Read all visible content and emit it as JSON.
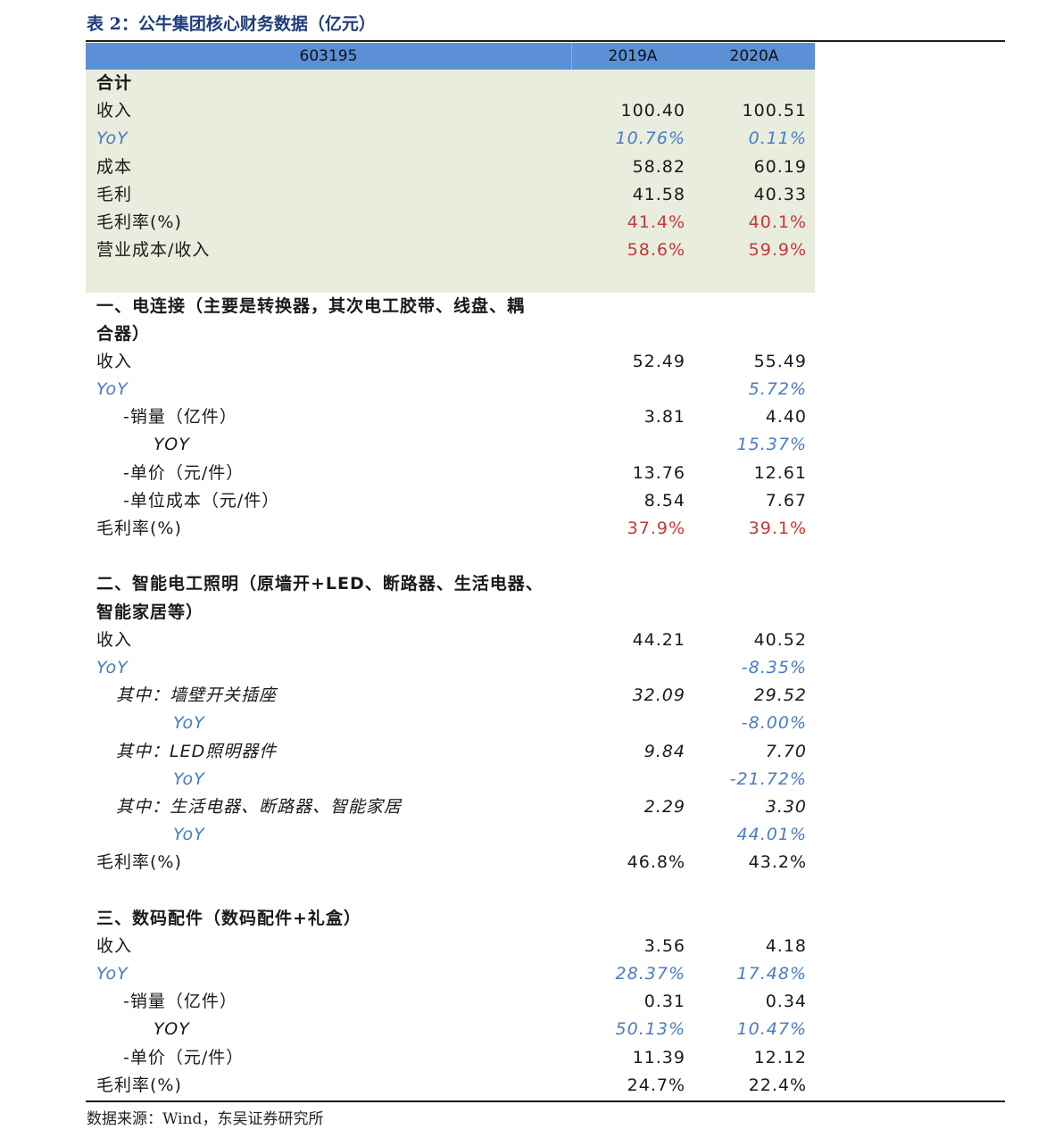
{
  "caption": "表 2：公牛集团核心财务数据（亿元）",
  "header": {
    "code": "603195",
    "col1": "2019A",
    "col2": "2020A"
  },
  "colors": {
    "header_bg": "#5b8fd6",
    "summary_bg": "#e8eddd",
    "yoy_blue": "#4a7cc2",
    "margin_red": "#c0393b",
    "caption_blue": "#1f3d7a"
  },
  "rows": [
    {
      "label": "合计",
      "v1": "",
      "v2": "",
      "style": "bold"
    },
    {
      "label": "收入",
      "v1": "100.40",
      "v2": "100.51",
      "style": ""
    },
    {
      "label": "YoY",
      "v1": "10.76%",
      "v2": "0.11%",
      "style": "blue"
    },
    {
      "label": "成本",
      "v1": "58.82",
      "v2": "60.19",
      "style": ""
    },
    {
      "label": "毛利",
      "v1": "41.58",
      "v2": "40.33",
      "style": ""
    },
    {
      "label": "毛利率(%)",
      "v1": "41.4%",
      "v2": "40.1%",
      "style": "red"
    },
    {
      "label": "营业成本/收入",
      "v1": "58.6%",
      "v2": "59.9%",
      "style": "red"
    },
    {
      "label": "",
      "v1": "",
      "v2": "",
      "style": ""
    },
    {
      "label": "一、电连接（主要是转换器，其次电工胶带、线盘、耦",
      "v1": "",
      "v2": "",
      "style": "bold"
    },
    {
      "label": "合器）",
      "v1": "",
      "v2": "",
      "style": "bold"
    },
    {
      "label": "收入",
      "v1": "52.49",
      "v2": "55.49",
      "style": ""
    },
    {
      "label": "YoY",
      "v1": "",
      "v2": "5.72%",
      "style": "blue"
    },
    {
      "label": "-销量（亿件）",
      "v1": "3.81",
      "v2": "4.40",
      "style": "ind1"
    },
    {
      "label": "YOY",
      "v1": "",
      "v2": "15.37%",
      "style": "ind2 blue-values"
    },
    {
      "label": "-单价（元/件）",
      "v1": "13.76",
      "v2": "12.61",
      "style": "ind1"
    },
    {
      "label": "-单位成本（元/件）",
      "v1": "8.54",
      "v2": "7.67",
      "style": "ind1"
    },
    {
      "label": "毛利率(%)",
      "v1": "37.9%",
      "v2": "39.1%",
      "style": "red"
    },
    {
      "label": "",
      "v1": "",
      "v2": "",
      "style": ""
    },
    {
      "label": "二、智能电工照明（原墙开+LED、断路器、生活电器、",
      "v1": "",
      "v2": "",
      "style": "bold"
    },
    {
      "label": "智能家居等）",
      "v1": "",
      "v2": "",
      "style": "bold"
    },
    {
      "label": "收入",
      "v1": "44.21",
      "v2": "40.52",
      "style": ""
    },
    {
      "label": "YoY",
      "v1": "",
      "v2": "-8.35%",
      "style": "blue"
    },
    {
      "label": "其中：墙壁开关插座",
      "v1": "32.09",
      "v2": "29.52",
      "style": "ind3 ital"
    },
    {
      "label": "YoY",
      "v1": "",
      "v2": "-8.00%",
      "style": "ind4 blue"
    },
    {
      "label": "其中：LED照明器件",
      "v1": "9.84",
      "v2": "7.70",
      "style": "ind3 ital"
    },
    {
      "label": "YoY",
      "v1": "",
      "v2": "-21.72%",
      "style": "ind4 blue"
    },
    {
      "label": "其中：生活电器、断路器、智能家居",
      "v1": "2.29",
      "v2": "3.30",
      "style": "ind3 ital"
    },
    {
      "label": "YoY",
      "v1": "",
      "v2": "44.01%",
      "style": "ind4 blue"
    },
    {
      "label": "毛利率(%)",
      "v1": "46.8%",
      "v2": "43.2%",
      "style": ""
    },
    {
      "label": "",
      "v1": "",
      "v2": "",
      "style": ""
    },
    {
      "label": "三、数码配件（数码配件+礼盒）",
      "v1": "",
      "v2": "",
      "style": "bold"
    },
    {
      "label": "收入",
      "v1": "3.56",
      "v2": "4.18",
      "style": ""
    },
    {
      "label": "YoY",
      "v1": "28.37%",
      "v2": "17.48%",
      "style": "blue"
    },
    {
      "label": "-销量（亿件）",
      "v1": "0.31",
      "v2": "0.34",
      "style": "ind1"
    },
    {
      "label": "YOY",
      "v1": "50.13%",
      "v2": "10.47%",
      "style": "ind2 blue-values"
    },
    {
      "label": "-单价（元/件）",
      "v1": "11.39",
      "v2": "12.12",
      "style": "ind1"
    },
    {
      "label": "毛利率(%)",
      "v1": "24.7%",
      "v2": "22.4%",
      "style": ""
    }
  ],
  "source": "数据来源：Wind，东吴证券研究所"
}
